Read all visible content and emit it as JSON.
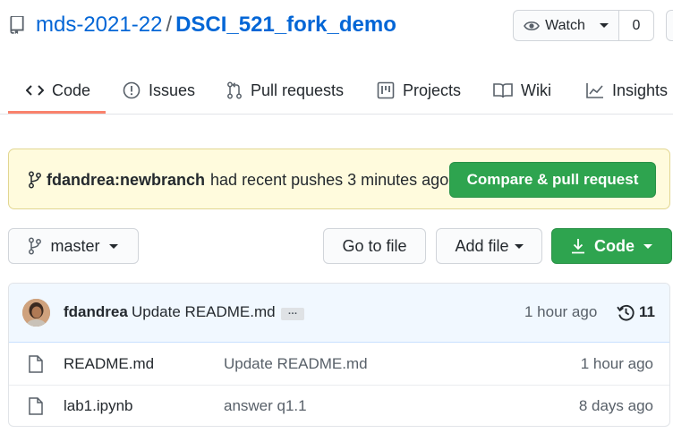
{
  "repo": {
    "owner": "mds-2021-22",
    "separator": "/",
    "name": "DSCI_521_fork_demo"
  },
  "watch": {
    "label": "Watch",
    "count": "0"
  },
  "tabs": [
    {
      "label": "Code",
      "icon": "code-icon",
      "active": true
    },
    {
      "label": "Issues",
      "icon": "issue-icon"
    },
    {
      "label": "Pull requests",
      "icon": "pull-request-icon"
    },
    {
      "label": "Projects",
      "icon": "project-icon"
    },
    {
      "label": "Wiki",
      "icon": "book-icon"
    },
    {
      "label": "Insights",
      "icon": "graph-icon"
    }
  ],
  "banner": {
    "branch": "fdandrea:newbranch",
    "text": "had recent pushes 3 minutes ago",
    "button": "Compare & pull request"
  },
  "toolbar": {
    "branch": "master",
    "goto_file": "Go to file",
    "add_file": "Add file",
    "code": "Code"
  },
  "latest_commit": {
    "author": "fdandrea",
    "message": "Update README.md",
    "ellipsis": "…",
    "time": "1 hour ago",
    "commit_count": "11"
  },
  "files": [
    {
      "name": "README.md",
      "message": "Update README.md",
      "time": "1 hour ago"
    },
    {
      "name": "lab1.ipynb",
      "message": "answer q1.1",
      "time": "8 days ago"
    }
  ],
  "colors": {
    "link": "#0366d6",
    "green": "#2ea44f",
    "tab_active": "#f9826c",
    "banner_bg": "#fffbdd"
  }
}
